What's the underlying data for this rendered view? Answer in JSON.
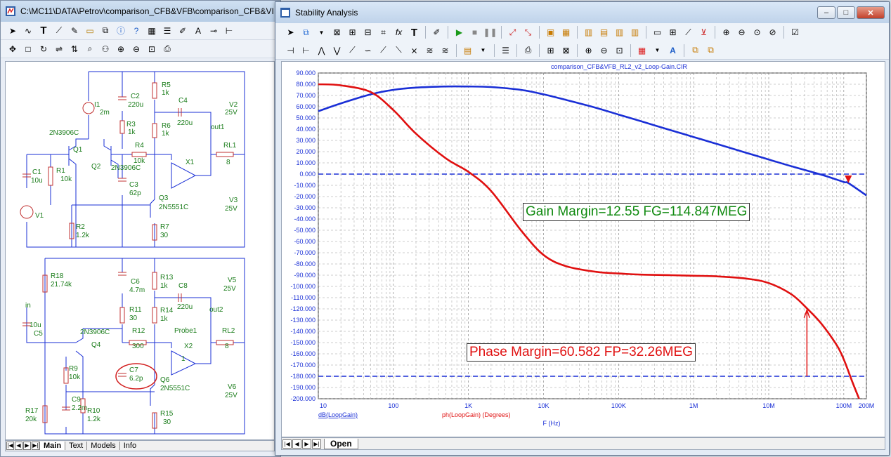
{
  "back_window": {
    "title": "C:\\MC11\\DATA\\Petrov\\comparison_CFB&VFB\\comparison_CFB&VI",
    "tabs": [
      "Main",
      "Text",
      "Models",
      "Info"
    ],
    "active_tab": "Main"
  },
  "schematic": {
    "labels": [
      "I1",
      "2m",
      "C2",
      "220u",
      "R5",
      "1k",
      "C4",
      "220u",
      "V2",
      "25V",
      "R3",
      "1k",
      "R6",
      "1k",
      "out1",
      "2N3906C",
      "Q1",
      "Q2",
      "R4",
      "10k",
      "2N3906C",
      "X1",
      "RL1",
      "8",
      "C1",
      "10u",
      "R1",
      "10k",
      "V1",
      "C3",
      "62p",
      "Q3",
      "2N5551C",
      "V3",
      "25V",
      "R2",
      "1.2k",
      "R7",
      "30",
      "R18",
      "21.74k",
      "C6",
      "4.7m",
      "R13",
      "1k",
      "C8",
      "V5",
      "25V",
      "R11",
      "30",
      "R14",
      "220u",
      "1k",
      "out2",
      "in",
      "10u",
      "C5",
      "2N3906C",
      "R12",
      "Probe1",
      "RL2",
      "X2",
      "Q4",
      "300",
      "8",
      "R9",
      "10k",
      "C7",
      "6.2p",
      "Q6",
      "2N5551C",
      "V6",
      "25V",
      "C9",
      "2.2m",
      "R17",
      "20k",
      "R10",
      "1.2k",
      "R15",
      "30",
      "1"
    ]
  },
  "front_window": {
    "title": "Stability Analysis",
    "window_buttons": [
      "–",
      "□",
      "✕"
    ],
    "tab": "Open"
  },
  "chart_data": {
    "type": "line",
    "title": "comparison_CFB&VFB_RL2_v2_Loop-Gain.CIR",
    "xlabel": "F (Hz)",
    "x_scale": "log",
    "xlim": [
      10,
      200000000
    ],
    "x_ticks": [
      {
        "v": 10,
        "label": "10"
      },
      {
        "v": 100,
        "label": "100"
      },
      {
        "v": 1000,
        "label": "1K"
      },
      {
        "v": 10000,
        "label": "10K"
      },
      {
        "v": 100000,
        "label": "100K"
      },
      {
        "v": 1000000,
        "label": "1M"
      },
      {
        "v": 10000000,
        "label": "10M"
      },
      {
        "v": 100000000,
        "label": "100M"
      },
      {
        "v": 200000000,
        "label": "200M"
      }
    ],
    "ylim": [
      -200,
      90
    ],
    "y_ticks": [
      90,
      80,
      70,
      60,
      50,
      40,
      30,
      20,
      10,
      0,
      -10,
      -20,
      -30,
      -40,
      -50,
      -60,
      -70,
      -80,
      -90,
      -100,
      -110,
      -120,
      -130,
      -140,
      -150,
      -160,
      -170,
      -180,
      -190,
      -200
    ],
    "y_tick_format": "fixed3",
    "grid": true,
    "reference_lines": [
      0,
      -180
    ],
    "series": [
      {
        "name": "dB(LoopGain)",
        "color": "#1a2fd6",
        "x": [
          10,
          20,
          50,
          100,
          200,
          500,
          1000,
          2000,
          5000,
          10000,
          20000,
          50000,
          100000,
          200000,
          500000,
          1000000,
          2000000,
          5000000,
          10000000,
          20000000,
          50000000,
          100000000,
          114847000,
          200000000
        ],
        "y": [
          56,
          63,
          71,
          75,
          77,
          78,
          78,
          77.5,
          75,
          71,
          66,
          59,
          53,
          47,
          39,
          33,
          27,
          19,
          13,
          7,
          -0.5,
          -7,
          -8,
          -19
        ]
      },
      {
        "name": "ph(LoopGain) (Degrees)",
        "color": "#e01010",
        "x": [
          10,
          20,
          50,
          100,
          200,
          500,
          1000,
          2000,
          5000,
          10000,
          20000,
          50000,
          100000,
          200000,
          500000,
          1000000,
          2000000,
          5000000,
          10000000,
          20000000,
          32260000,
          50000000,
          80000000,
          100000000,
          130000000,
          160000000
        ],
        "y": [
          80,
          79,
          73,
          57,
          36,
          14,
          2,
          -15,
          -50,
          -72,
          -82,
          -87,
          -88.5,
          -89.5,
          -90,
          -90.5,
          -91,
          -93,
          -97,
          -107,
          -119.5,
          -133,
          -152,
          -165,
          -185,
          -200
        ]
      }
    ],
    "margin_markers": [
      {
        "label": "Gain Margin=12.55 FG=114.847MEG",
        "freq": 114847000,
        "color": "#108a10"
      },
      {
        "label": "Phase Margin=60.582 FP=32.26MEG",
        "freq": 32260000,
        "color": "#e01010"
      }
    ]
  }
}
